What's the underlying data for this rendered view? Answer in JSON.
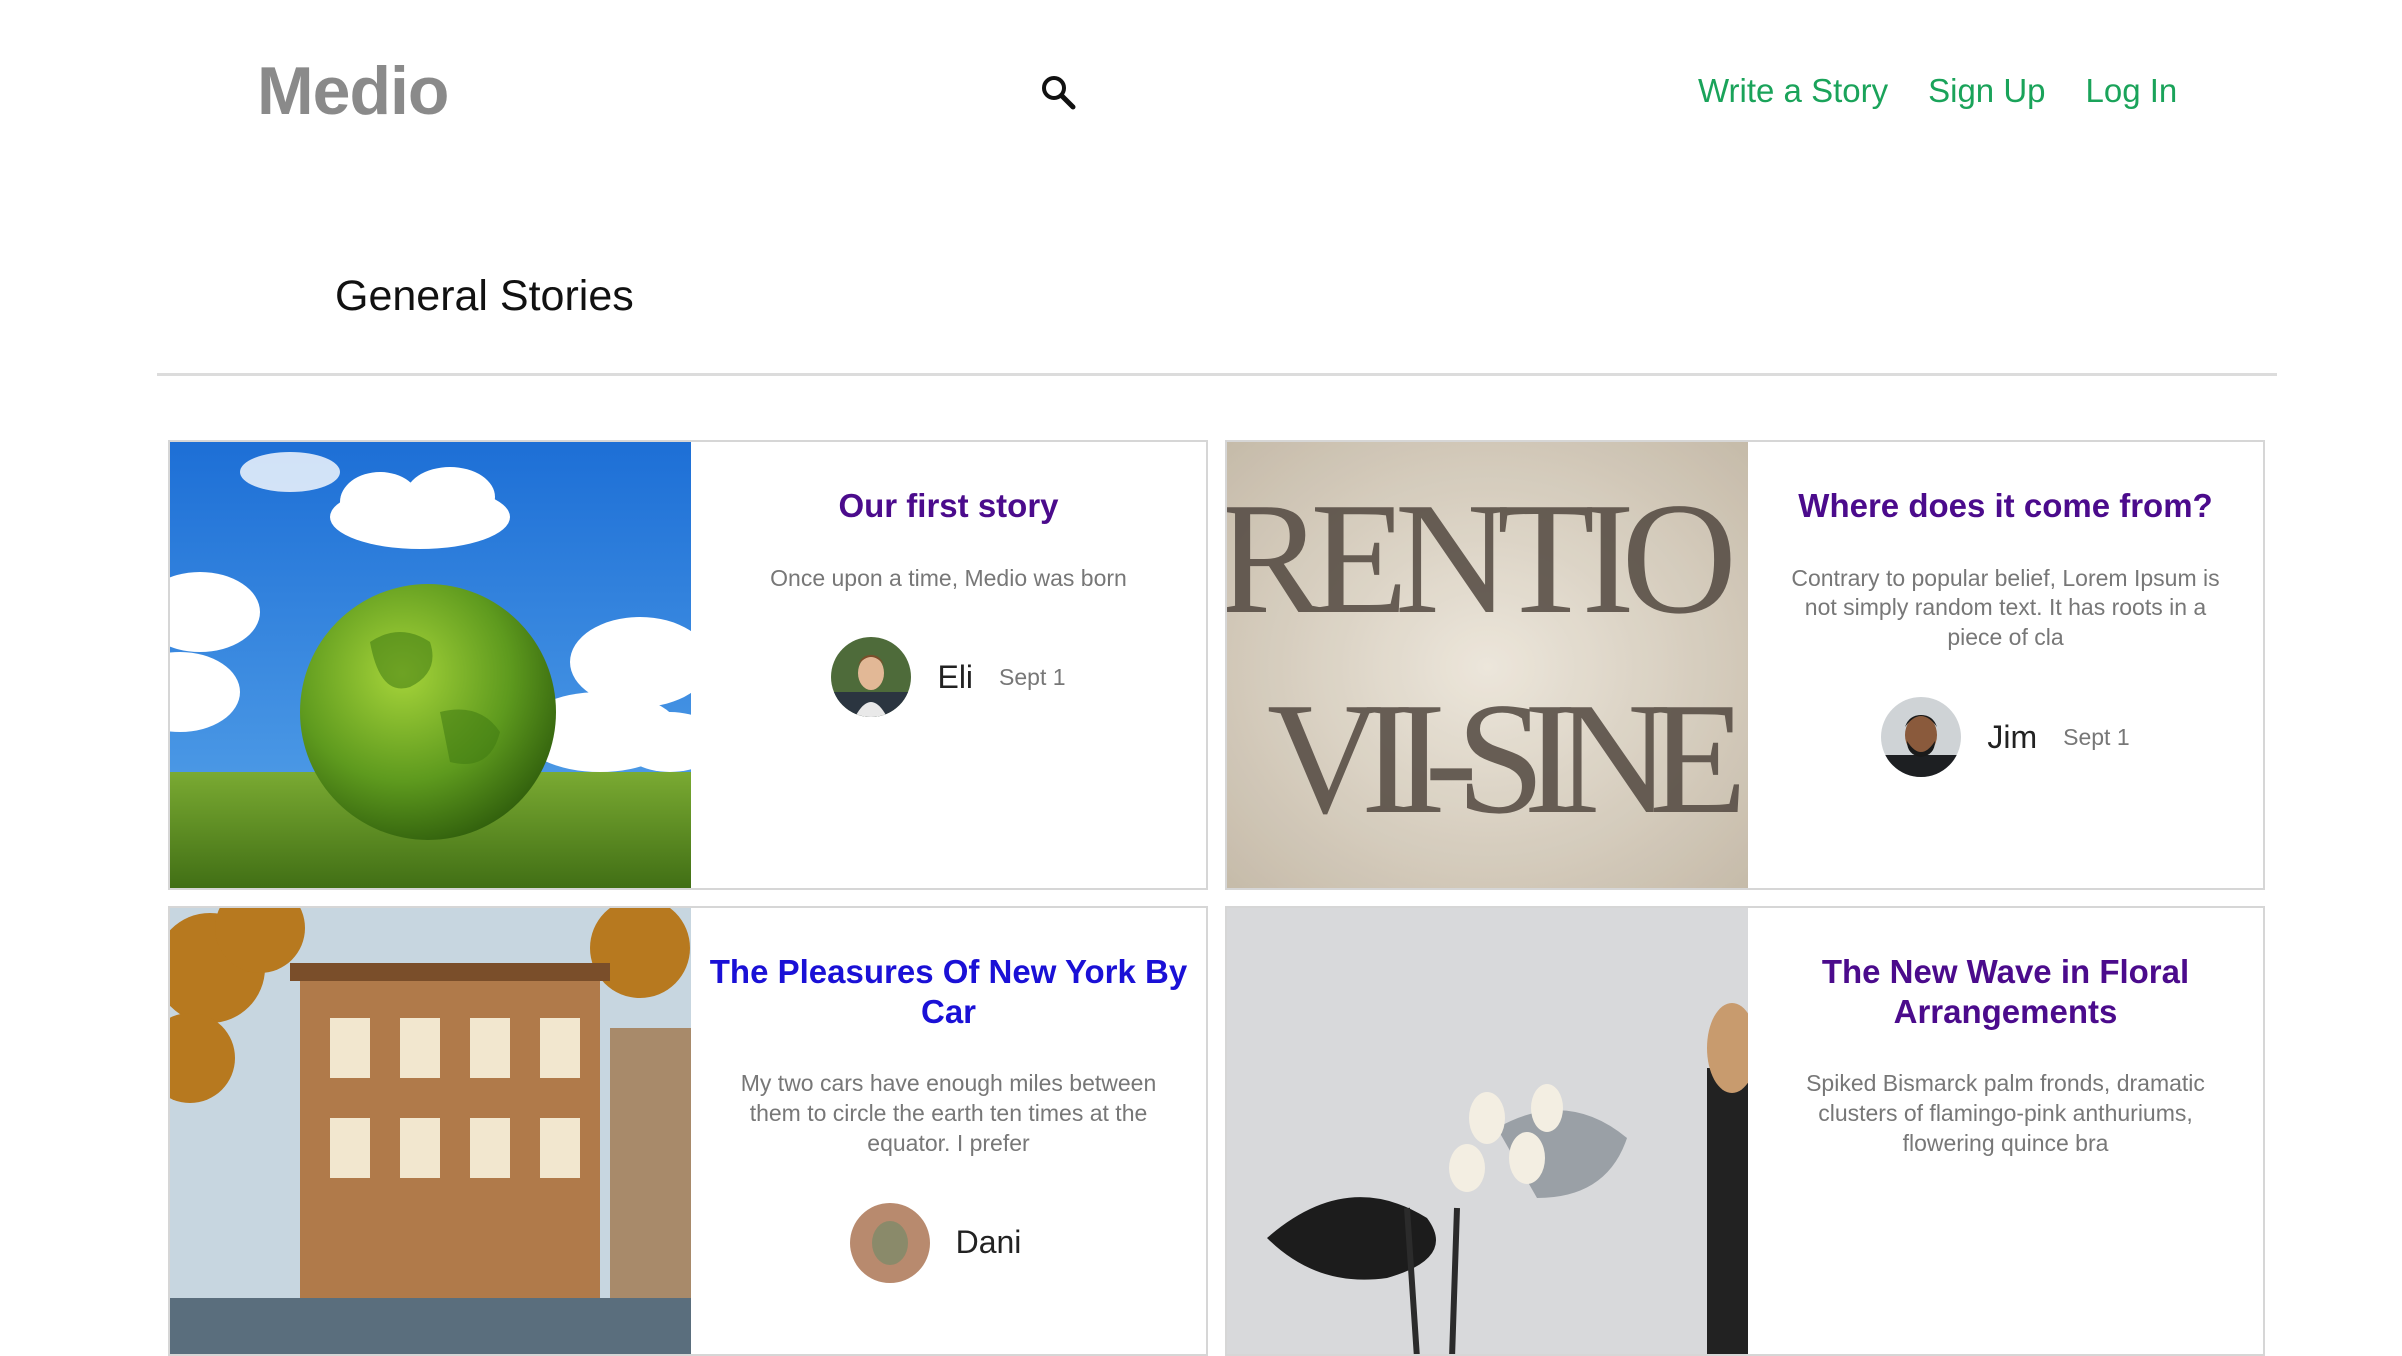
{
  "header": {
    "logo": "Medio",
    "nav": {
      "write": "Write a Story",
      "signup": "Sign Up",
      "login": "Log In"
    }
  },
  "section": {
    "title": "General Stories"
  },
  "stories": [
    {
      "title": "Our first story",
      "excerpt": "Once upon a time, Medio was born",
      "author": "Eli",
      "date": "Sept 1",
      "image": "green-grass-globe-photo"
    },
    {
      "title": "Where does it come from?",
      "excerpt": "Contrary to popular belief, Lorem Ipsum is not simply random text. It has roots in a piece of cla",
      "author": "Jim",
      "date": "Sept 1",
      "image": "carved-latin-inscription-photo"
    },
    {
      "title": "The Pleasures Of New York By Car",
      "excerpt": "My two cars have enough miles between them to circle the earth ten times at the equator. I prefer",
      "author": "Dani",
      "date": "",
      "image": "brownstone-street-photo"
    },
    {
      "title": "The New Wave in Floral Arrangements",
      "excerpt": "Spiked Bismarck palm fronds, dramatic clusters of flamingo-pink anthuriums, flowering quince bra",
      "author": "",
      "date": "",
      "image": "floral-arrangement-photo"
    }
  ],
  "colors": {
    "logo": "#8a8a8a",
    "nav": "#1aa35a",
    "title": "#4b0b8c",
    "title_visited": "#1a10d6"
  }
}
